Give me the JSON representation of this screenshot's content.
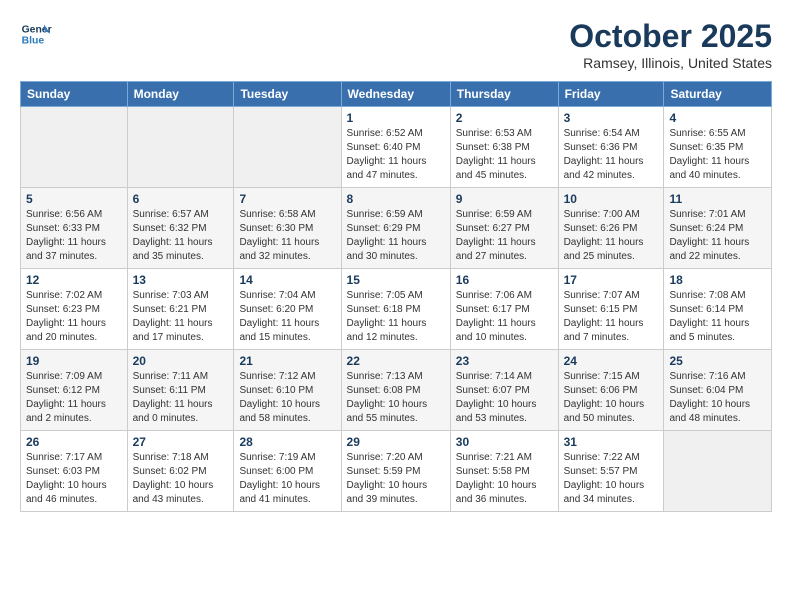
{
  "header": {
    "logo_line1": "General",
    "logo_line2": "Blue",
    "month": "October 2025",
    "location": "Ramsey, Illinois, United States"
  },
  "weekdays": [
    "Sunday",
    "Monday",
    "Tuesday",
    "Wednesday",
    "Thursday",
    "Friday",
    "Saturday"
  ],
  "weeks": [
    [
      {
        "day": "",
        "info": ""
      },
      {
        "day": "",
        "info": ""
      },
      {
        "day": "",
        "info": ""
      },
      {
        "day": "1",
        "info": "Sunrise: 6:52 AM\nSunset: 6:40 PM\nDaylight: 11 hours\nand 47 minutes."
      },
      {
        "day": "2",
        "info": "Sunrise: 6:53 AM\nSunset: 6:38 PM\nDaylight: 11 hours\nand 45 minutes."
      },
      {
        "day": "3",
        "info": "Sunrise: 6:54 AM\nSunset: 6:36 PM\nDaylight: 11 hours\nand 42 minutes."
      },
      {
        "day": "4",
        "info": "Sunrise: 6:55 AM\nSunset: 6:35 PM\nDaylight: 11 hours\nand 40 minutes."
      }
    ],
    [
      {
        "day": "5",
        "info": "Sunrise: 6:56 AM\nSunset: 6:33 PM\nDaylight: 11 hours\nand 37 minutes."
      },
      {
        "day": "6",
        "info": "Sunrise: 6:57 AM\nSunset: 6:32 PM\nDaylight: 11 hours\nand 35 minutes."
      },
      {
        "day": "7",
        "info": "Sunrise: 6:58 AM\nSunset: 6:30 PM\nDaylight: 11 hours\nand 32 minutes."
      },
      {
        "day": "8",
        "info": "Sunrise: 6:59 AM\nSunset: 6:29 PM\nDaylight: 11 hours\nand 30 minutes."
      },
      {
        "day": "9",
        "info": "Sunrise: 6:59 AM\nSunset: 6:27 PM\nDaylight: 11 hours\nand 27 minutes."
      },
      {
        "day": "10",
        "info": "Sunrise: 7:00 AM\nSunset: 6:26 PM\nDaylight: 11 hours\nand 25 minutes."
      },
      {
        "day": "11",
        "info": "Sunrise: 7:01 AM\nSunset: 6:24 PM\nDaylight: 11 hours\nand 22 minutes."
      }
    ],
    [
      {
        "day": "12",
        "info": "Sunrise: 7:02 AM\nSunset: 6:23 PM\nDaylight: 11 hours\nand 20 minutes."
      },
      {
        "day": "13",
        "info": "Sunrise: 7:03 AM\nSunset: 6:21 PM\nDaylight: 11 hours\nand 17 minutes."
      },
      {
        "day": "14",
        "info": "Sunrise: 7:04 AM\nSunset: 6:20 PM\nDaylight: 11 hours\nand 15 minutes."
      },
      {
        "day": "15",
        "info": "Sunrise: 7:05 AM\nSunset: 6:18 PM\nDaylight: 11 hours\nand 12 minutes."
      },
      {
        "day": "16",
        "info": "Sunrise: 7:06 AM\nSunset: 6:17 PM\nDaylight: 11 hours\nand 10 minutes."
      },
      {
        "day": "17",
        "info": "Sunrise: 7:07 AM\nSunset: 6:15 PM\nDaylight: 11 hours\nand 7 minutes."
      },
      {
        "day": "18",
        "info": "Sunrise: 7:08 AM\nSunset: 6:14 PM\nDaylight: 11 hours\nand 5 minutes."
      }
    ],
    [
      {
        "day": "19",
        "info": "Sunrise: 7:09 AM\nSunset: 6:12 PM\nDaylight: 11 hours\nand 2 minutes."
      },
      {
        "day": "20",
        "info": "Sunrise: 7:11 AM\nSunset: 6:11 PM\nDaylight: 11 hours\nand 0 minutes."
      },
      {
        "day": "21",
        "info": "Sunrise: 7:12 AM\nSunset: 6:10 PM\nDaylight: 10 hours\nand 58 minutes."
      },
      {
        "day": "22",
        "info": "Sunrise: 7:13 AM\nSunset: 6:08 PM\nDaylight: 10 hours\nand 55 minutes."
      },
      {
        "day": "23",
        "info": "Sunrise: 7:14 AM\nSunset: 6:07 PM\nDaylight: 10 hours\nand 53 minutes."
      },
      {
        "day": "24",
        "info": "Sunrise: 7:15 AM\nSunset: 6:06 PM\nDaylight: 10 hours\nand 50 minutes."
      },
      {
        "day": "25",
        "info": "Sunrise: 7:16 AM\nSunset: 6:04 PM\nDaylight: 10 hours\nand 48 minutes."
      }
    ],
    [
      {
        "day": "26",
        "info": "Sunrise: 7:17 AM\nSunset: 6:03 PM\nDaylight: 10 hours\nand 46 minutes."
      },
      {
        "day": "27",
        "info": "Sunrise: 7:18 AM\nSunset: 6:02 PM\nDaylight: 10 hours\nand 43 minutes."
      },
      {
        "day": "28",
        "info": "Sunrise: 7:19 AM\nSunset: 6:00 PM\nDaylight: 10 hours\nand 41 minutes."
      },
      {
        "day": "29",
        "info": "Sunrise: 7:20 AM\nSunset: 5:59 PM\nDaylight: 10 hours\nand 39 minutes."
      },
      {
        "day": "30",
        "info": "Sunrise: 7:21 AM\nSunset: 5:58 PM\nDaylight: 10 hours\nand 36 minutes."
      },
      {
        "day": "31",
        "info": "Sunrise: 7:22 AM\nSunset: 5:57 PM\nDaylight: 10 hours\nand 34 minutes."
      },
      {
        "day": "",
        "info": ""
      }
    ]
  ]
}
